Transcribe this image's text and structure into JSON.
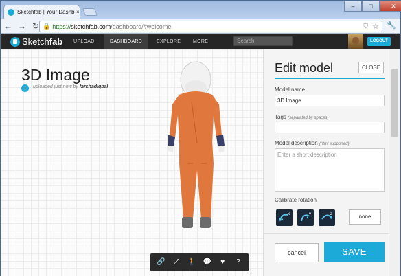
{
  "browser": {
    "tab_title": "Sketchfab | Your Dashboard",
    "tab_close": "×",
    "url_scheme": "https://",
    "url_host": "sketchfab.com",
    "url_path": "/dashboard/#welcome",
    "window_controls": [
      "–",
      "□",
      "✕"
    ]
  },
  "site_nav": {
    "logo_text_light": "Sketch",
    "logo_text_bold": "fab",
    "items": [
      "UPLOAD",
      "DASHBOARD",
      "EXPLORE",
      "MORE"
    ],
    "active": "DASHBOARD",
    "search_placeholder": "Search",
    "logout_label": "LOGOUT"
  },
  "viewer": {
    "model_title": "3D Image",
    "info_glyph": "i",
    "uploaded_text": "uploaded just now by ",
    "uploader": "farshadiqbal",
    "toolbar_icons": [
      "link-icon",
      "fullscreen-icon",
      "walk-icon",
      "comment-icon",
      "heart-icon",
      "help-icon"
    ],
    "toolbar_glyphs": [
      "🔗",
      "⤢",
      "🚶",
      "💬",
      "♥",
      "?"
    ]
  },
  "edit_panel": {
    "title": "Edit model",
    "close_label": "CLOSE",
    "name_label": "Model name",
    "name_value": "3D Image",
    "tags_label": "Tags",
    "tags_hint": "(separated by spaces)",
    "tags_value": "",
    "desc_label": "Model description",
    "desc_hint": "(html supported)",
    "desc_placeholder": "Enter a short description",
    "calibrate_label": "Calibrate rotation",
    "rotation_axes": [
      "x",
      "y",
      "z"
    ],
    "none_label": "none",
    "cancel_label": "cancel",
    "save_label": "SAVE"
  },
  "colors": {
    "accent": "#1caad9",
    "nav_bg": "#262626",
    "suit": "#e0773c"
  }
}
